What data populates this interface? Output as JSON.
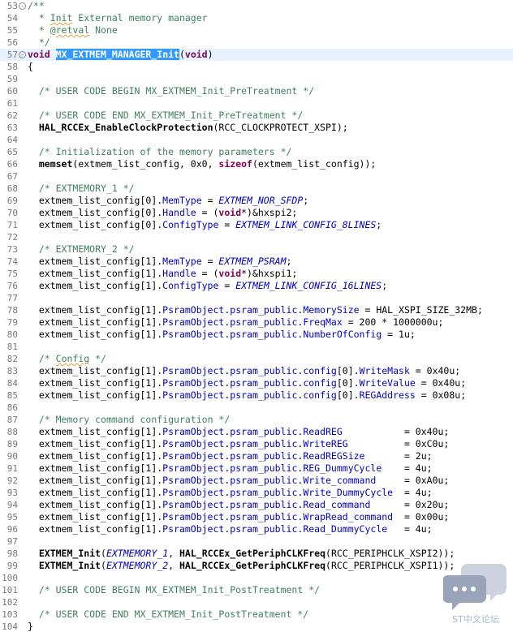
{
  "editor": {
    "lines": [
      {
        "no": "53",
        "fold": "-",
        "tokens": [
          {
            "t": "cmt",
            "v": "/**"
          }
        ]
      },
      {
        "no": "54",
        "tokens": [
          {
            "t": "cmt",
            "v": "  * "
          },
          {
            "t": "cmt",
            "v": "Init",
            "squig": true
          },
          {
            "t": "cmt",
            "v": " External memory manager"
          }
        ]
      },
      {
        "no": "55",
        "tokens": [
          {
            "t": "cmt",
            "v": "  * "
          },
          {
            "t": "cmt",
            "v": "@retval",
            "squig": true
          },
          {
            "t": "cmt",
            "v": " None"
          }
        ]
      },
      {
        "no": "56",
        "tokens": [
          {
            "t": "cmt",
            "v": "  */"
          }
        ]
      },
      {
        "no": "57",
        "fold": "-",
        "current": true,
        "tokens": [
          {
            "t": "kw",
            "v": "void"
          },
          {
            "t": "pl",
            "v": " "
          },
          {
            "t": "sel",
            "v": "MX_EXTMEM_MANAGER_Init"
          },
          {
            "t": "pl",
            "v": "("
          },
          {
            "t": "kw",
            "v": "void"
          },
          {
            "t": "pl",
            "v": ")"
          }
        ]
      },
      {
        "no": "58",
        "tokens": [
          {
            "t": "pl",
            "v": "{"
          }
        ]
      },
      {
        "no": "59",
        "tokens": []
      },
      {
        "no": "60",
        "tokens": [
          {
            "t": "pl",
            "v": "  "
          },
          {
            "t": "cmt",
            "v": "/* USER CODE BEGIN MX_EXTMEM_Init_PreTreatment */"
          }
        ]
      },
      {
        "no": "61",
        "tokens": []
      },
      {
        "no": "62",
        "tokens": [
          {
            "t": "pl",
            "v": "  "
          },
          {
            "t": "cmt",
            "v": "/* USER CODE END MX_EXTMEM_Init_PreTreatment */"
          }
        ]
      },
      {
        "no": "63",
        "tokens": [
          {
            "t": "pl",
            "v": "  "
          },
          {
            "t": "fn",
            "v": "HAL_RCCEx_EnableClockProtection"
          },
          {
            "t": "pl",
            "v": "(RCC_CLOCKPROTECT_XSPI);"
          }
        ]
      },
      {
        "no": "64",
        "tokens": []
      },
      {
        "no": "65",
        "tokens": [
          {
            "t": "pl",
            "v": "  "
          },
          {
            "t": "cmt",
            "v": "/* Initialization of the memory parameters */"
          }
        ]
      },
      {
        "no": "66",
        "tokens": [
          {
            "t": "pl",
            "v": "  "
          },
          {
            "t": "fn",
            "v": "memset"
          },
          {
            "t": "pl",
            "v": "(extmem_list_config, 0x0, "
          },
          {
            "t": "kw",
            "v": "sizeof"
          },
          {
            "t": "pl",
            "v": "(extmem_list_config));"
          }
        ]
      },
      {
        "no": "67",
        "tokens": []
      },
      {
        "no": "68",
        "tokens": [
          {
            "t": "pl",
            "v": "  "
          },
          {
            "t": "cmt",
            "v": "/* EXTMEMORY_1 */"
          }
        ]
      },
      {
        "no": "69",
        "tokens": [
          {
            "t": "pl",
            "v": "  extmem_list_config[0]."
          },
          {
            "t": "mem",
            "v": "MemType"
          },
          {
            "t": "pl",
            "v": " = "
          },
          {
            "t": "macro",
            "v": "EXTMEM_NOR_SFDP"
          },
          {
            "t": "pl",
            "v": ";"
          }
        ]
      },
      {
        "no": "70",
        "tokens": [
          {
            "t": "pl",
            "v": "  extmem_list_config[0]."
          },
          {
            "t": "mem",
            "v": "Handle"
          },
          {
            "t": "pl",
            "v": " = ("
          },
          {
            "t": "kw",
            "v": "void"
          },
          {
            "t": "pl",
            "v": "*)&hxspi2;"
          }
        ]
      },
      {
        "no": "71",
        "tokens": [
          {
            "t": "pl",
            "v": "  extmem_list_config[0]."
          },
          {
            "t": "mem",
            "v": "ConfigType"
          },
          {
            "t": "pl",
            "v": " = "
          },
          {
            "t": "macro",
            "v": "EXTMEM_LINK_CONFIG_8LINES"
          },
          {
            "t": "pl",
            "v": ";"
          }
        ]
      },
      {
        "no": "72",
        "tokens": []
      },
      {
        "no": "73",
        "tokens": [
          {
            "t": "pl",
            "v": "  "
          },
          {
            "t": "cmt",
            "v": "/* EXTMEMORY_2 */"
          }
        ]
      },
      {
        "no": "74",
        "tokens": [
          {
            "t": "pl",
            "v": "  extmem_list_config[1]."
          },
          {
            "t": "mem",
            "v": "MemType"
          },
          {
            "t": "pl",
            "v": " = "
          },
          {
            "t": "macro",
            "v": "EXTMEM_PSRAM"
          },
          {
            "t": "pl",
            "v": ";"
          }
        ]
      },
      {
        "no": "75",
        "tokens": [
          {
            "t": "pl",
            "v": "  extmem_list_config[1]."
          },
          {
            "t": "mem",
            "v": "Handle"
          },
          {
            "t": "pl",
            "v": " = ("
          },
          {
            "t": "kw",
            "v": "void"
          },
          {
            "t": "pl",
            "v": "*)&hxspi1;"
          }
        ]
      },
      {
        "no": "76",
        "tokens": [
          {
            "t": "pl",
            "v": "  extmem_list_config[1]."
          },
          {
            "t": "mem",
            "v": "ConfigType"
          },
          {
            "t": "pl",
            "v": " = "
          },
          {
            "t": "macro",
            "v": "EXTMEM_LINK_CONFIG_16LINES"
          },
          {
            "t": "pl",
            "v": ";"
          }
        ]
      },
      {
        "no": "77",
        "tokens": []
      },
      {
        "no": "78",
        "tokens": [
          {
            "t": "pl",
            "v": "  extmem_list_config[1]."
          },
          {
            "t": "mem",
            "v": "PsramObject"
          },
          {
            "t": "pl",
            "v": "."
          },
          {
            "t": "mem",
            "v": "psram_public"
          },
          {
            "t": "pl",
            "v": "."
          },
          {
            "t": "mem",
            "v": "MemorySize"
          },
          {
            "t": "pl",
            "v": " = HAL_XSPI_SIZE_32MB;"
          }
        ]
      },
      {
        "no": "79",
        "tokens": [
          {
            "t": "pl",
            "v": "  extmem_list_config[1]."
          },
          {
            "t": "mem",
            "v": "PsramObject"
          },
          {
            "t": "pl",
            "v": "."
          },
          {
            "t": "mem",
            "v": "psram_public"
          },
          {
            "t": "pl",
            "v": "."
          },
          {
            "t": "mem",
            "v": "FreqMax"
          },
          {
            "t": "pl",
            "v": " = 200 * 1000000u;"
          }
        ]
      },
      {
        "no": "80",
        "tokens": [
          {
            "t": "pl",
            "v": "  extmem_list_config[1]."
          },
          {
            "t": "mem",
            "v": "PsramObject"
          },
          {
            "t": "pl",
            "v": "."
          },
          {
            "t": "mem",
            "v": "psram_public"
          },
          {
            "t": "pl",
            "v": "."
          },
          {
            "t": "mem",
            "v": "NumberOfConfig"
          },
          {
            "t": "pl",
            "v": " = 1u;"
          }
        ]
      },
      {
        "no": "81",
        "tokens": []
      },
      {
        "no": "82",
        "tokens": [
          {
            "t": "pl",
            "v": "  "
          },
          {
            "t": "cmt",
            "v": "/* "
          },
          {
            "t": "cmt",
            "v": "Config",
            "squig": true
          },
          {
            "t": "cmt",
            "v": " */"
          }
        ]
      },
      {
        "no": "83",
        "tokens": [
          {
            "t": "pl",
            "v": "  extmem_list_config[1]."
          },
          {
            "t": "mem",
            "v": "PsramObject"
          },
          {
            "t": "pl",
            "v": "."
          },
          {
            "t": "mem",
            "v": "psram_public"
          },
          {
            "t": "pl",
            "v": "."
          },
          {
            "t": "mem",
            "v": "config"
          },
          {
            "t": "pl",
            "v": "[0]."
          },
          {
            "t": "mem",
            "v": "WriteMask"
          },
          {
            "t": "pl",
            "v": " = 0x40u;"
          }
        ]
      },
      {
        "no": "84",
        "tokens": [
          {
            "t": "pl",
            "v": "  extmem_list_config[1]."
          },
          {
            "t": "mem",
            "v": "PsramObject"
          },
          {
            "t": "pl",
            "v": "."
          },
          {
            "t": "mem",
            "v": "psram_public"
          },
          {
            "t": "pl",
            "v": "."
          },
          {
            "t": "mem",
            "v": "config"
          },
          {
            "t": "pl",
            "v": "[0]."
          },
          {
            "t": "mem",
            "v": "WriteValue"
          },
          {
            "t": "pl",
            "v": " = 0x40u;"
          }
        ]
      },
      {
        "no": "85",
        "tokens": [
          {
            "t": "pl",
            "v": "  extmem_list_config[1]."
          },
          {
            "t": "mem",
            "v": "PsramObject"
          },
          {
            "t": "pl",
            "v": "."
          },
          {
            "t": "mem",
            "v": "psram_public"
          },
          {
            "t": "pl",
            "v": "."
          },
          {
            "t": "mem",
            "v": "config"
          },
          {
            "t": "pl",
            "v": "[0]."
          },
          {
            "t": "mem",
            "v": "REGAddress"
          },
          {
            "t": "pl",
            "v": " = 0x08u;"
          }
        ]
      },
      {
        "no": "86",
        "tokens": []
      },
      {
        "no": "87",
        "tokens": [
          {
            "t": "pl",
            "v": "  "
          },
          {
            "t": "cmt",
            "v": "/* Memory command configuration */"
          }
        ]
      },
      {
        "no": "88",
        "tokens": [
          {
            "t": "pl",
            "v": "  extmem_list_config[1]."
          },
          {
            "t": "mem",
            "v": "PsramObject"
          },
          {
            "t": "pl",
            "v": "."
          },
          {
            "t": "mem",
            "v": "psram_public"
          },
          {
            "t": "pl",
            "v": "."
          },
          {
            "t": "mem",
            "v": "ReadREG"
          },
          {
            "t": "pl",
            "v": "           = 0x40u;"
          }
        ]
      },
      {
        "no": "89",
        "tokens": [
          {
            "t": "pl",
            "v": "  extmem_list_config[1]."
          },
          {
            "t": "mem",
            "v": "PsramObject"
          },
          {
            "t": "pl",
            "v": "."
          },
          {
            "t": "mem",
            "v": "psram_public"
          },
          {
            "t": "pl",
            "v": "."
          },
          {
            "t": "mem",
            "v": "WriteREG"
          },
          {
            "t": "pl",
            "v": "          = 0xC0u;"
          }
        ]
      },
      {
        "no": "90",
        "tokens": [
          {
            "t": "pl",
            "v": "  extmem_list_config[1]."
          },
          {
            "t": "mem",
            "v": "PsramObject"
          },
          {
            "t": "pl",
            "v": "."
          },
          {
            "t": "mem",
            "v": "psram_public"
          },
          {
            "t": "pl",
            "v": "."
          },
          {
            "t": "mem",
            "v": "ReadREGSize"
          },
          {
            "t": "pl",
            "v": "       = 2u;"
          }
        ]
      },
      {
        "no": "91",
        "tokens": [
          {
            "t": "pl",
            "v": "  extmem_list_config[1]."
          },
          {
            "t": "mem",
            "v": "PsramObject"
          },
          {
            "t": "pl",
            "v": "."
          },
          {
            "t": "mem",
            "v": "psram_public"
          },
          {
            "t": "pl",
            "v": "."
          },
          {
            "t": "mem",
            "v": "REG_DummyCycle"
          },
          {
            "t": "pl",
            "v": "    = 4u;"
          }
        ]
      },
      {
        "no": "92",
        "tokens": [
          {
            "t": "pl",
            "v": "  extmem_list_config[1]."
          },
          {
            "t": "mem",
            "v": "PsramObject"
          },
          {
            "t": "pl",
            "v": "."
          },
          {
            "t": "mem",
            "v": "psram_public"
          },
          {
            "t": "pl",
            "v": "."
          },
          {
            "t": "mem",
            "v": "Write_command"
          },
          {
            "t": "pl",
            "v": "     = 0xA0u;"
          }
        ]
      },
      {
        "no": "93",
        "tokens": [
          {
            "t": "pl",
            "v": "  extmem_list_config[1]."
          },
          {
            "t": "mem",
            "v": "PsramObject"
          },
          {
            "t": "pl",
            "v": "."
          },
          {
            "t": "mem",
            "v": "psram_public"
          },
          {
            "t": "pl",
            "v": "."
          },
          {
            "t": "mem",
            "v": "Write_DummyCycle"
          },
          {
            "t": "pl",
            "v": "  = 4u;"
          }
        ]
      },
      {
        "no": "94",
        "tokens": [
          {
            "t": "pl",
            "v": "  extmem_list_config[1]."
          },
          {
            "t": "mem",
            "v": "PsramObject"
          },
          {
            "t": "pl",
            "v": "."
          },
          {
            "t": "mem",
            "v": "psram_public"
          },
          {
            "t": "pl",
            "v": "."
          },
          {
            "t": "mem",
            "v": "Read_command"
          },
          {
            "t": "pl",
            "v": "      = 0x20u;"
          }
        ]
      },
      {
        "no": "95",
        "tokens": [
          {
            "t": "pl",
            "v": "  extmem_list_config[1]."
          },
          {
            "t": "mem",
            "v": "PsramObject"
          },
          {
            "t": "pl",
            "v": "."
          },
          {
            "t": "mem",
            "v": "psram_public"
          },
          {
            "t": "pl",
            "v": "."
          },
          {
            "t": "mem",
            "v": "WrapRead_command"
          },
          {
            "t": "pl",
            "v": "  = 0x00u;"
          }
        ]
      },
      {
        "no": "96",
        "tokens": [
          {
            "t": "pl",
            "v": "  extmem_list_config[1]."
          },
          {
            "t": "mem",
            "v": "PsramObject"
          },
          {
            "t": "pl",
            "v": "."
          },
          {
            "t": "mem",
            "v": "psram_public"
          },
          {
            "t": "pl",
            "v": "."
          },
          {
            "t": "mem",
            "v": "Read_DummyCycle"
          },
          {
            "t": "pl",
            "v": "   = 4u;"
          }
        ]
      },
      {
        "no": "97",
        "tokens": []
      },
      {
        "no": "98",
        "tokens": [
          {
            "t": "pl",
            "v": "  "
          },
          {
            "t": "fn",
            "v": "EXTMEM_Init"
          },
          {
            "t": "pl",
            "v": "("
          },
          {
            "t": "macro",
            "v": "EXTMEMORY_1"
          },
          {
            "t": "pl",
            "v": ", "
          },
          {
            "t": "fn",
            "v": "HAL_RCCEx_GetPeriphCLKFreq"
          },
          {
            "t": "pl",
            "v": "(RCC_PERIPHCLK_XSPI2));"
          }
        ]
      },
      {
        "no": "99",
        "tokens": [
          {
            "t": "pl",
            "v": "  "
          },
          {
            "t": "fn",
            "v": "EXTMEM_Init"
          },
          {
            "t": "pl",
            "v": "("
          },
          {
            "t": "macro",
            "v": "EXTMEMORY_2"
          },
          {
            "t": "pl",
            "v": ", "
          },
          {
            "t": "fn",
            "v": "HAL_RCCEx_GetPeriphCLKFreq"
          },
          {
            "t": "pl",
            "v": "(RCC_PERIPHCLK_XSPI1));"
          }
        ]
      },
      {
        "no": "100",
        "tokens": []
      },
      {
        "no": "101",
        "tokens": [
          {
            "t": "pl",
            "v": "  "
          },
          {
            "t": "cmt",
            "v": "/* USER CODE BEGIN MX_EXTMEM_Init_PostTreatment */"
          }
        ]
      },
      {
        "no": "102",
        "tokens": []
      },
      {
        "no": "103",
        "tokens": [
          {
            "t": "pl",
            "v": "  "
          },
          {
            "t": "cmt",
            "v": "/* USER CODE END MX_EXTMEM_Init_PostTreatment */"
          }
        ]
      },
      {
        "no": "104",
        "tokens": [
          {
            "t": "pl",
            "v": "}"
          }
        ]
      }
    ]
  },
  "watermark": {
    "icon": "chat-bubbles-icon",
    "text": "ST中文论坛"
  },
  "colors": {
    "comment": "#3f7f5f",
    "keyword": "#7f0055",
    "member": "#0000c0",
    "selection": "#3399ff",
    "current_line": "#e8f2fe",
    "line_number": "#787878"
  }
}
